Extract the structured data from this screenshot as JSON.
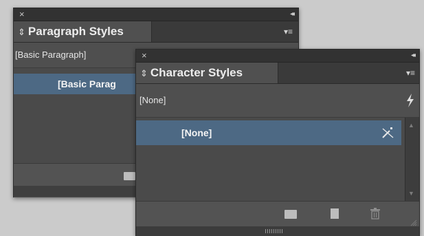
{
  "paragraph_panel": {
    "close_glyph": "×",
    "collapse_glyph": "◂◂",
    "tab_arrows": "⇕",
    "tab_title": "Paragraph Styles",
    "menu_glyph": "▾≡",
    "current_style": "[Basic Paragraph]",
    "selected_style": "[Basic Parag"
  },
  "character_panel": {
    "close_glyph": "×",
    "collapse_glyph": "◂◂",
    "tab_arrows": "⇕",
    "tab_title": "Character Styles",
    "menu_glyph": "▾≡",
    "current_style": "[None]",
    "selected_style": "[None]"
  },
  "colors": {
    "panel_bg": "#535353",
    "title_bar": "#323232",
    "selection": "#4d6984",
    "text": "#ececec"
  },
  "icons": {
    "lightning": "lightning-icon",
    "no_edit": "pencil-crossed-icon",
    "new_group": "folder-icon",
    "new_style": "new-page-icon",
    "delete": "trash-icon"
  }
}
